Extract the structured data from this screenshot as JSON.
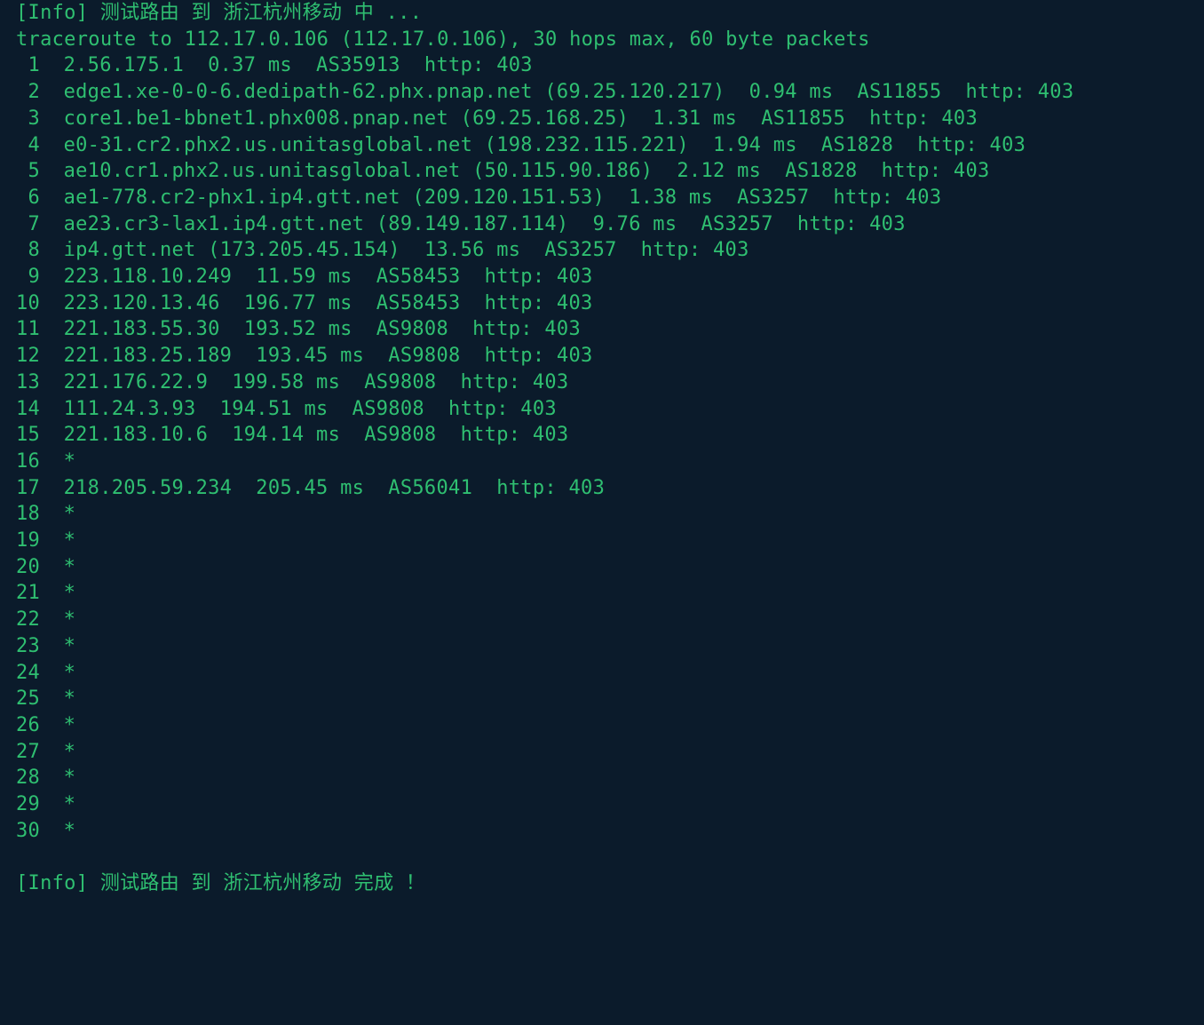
{
  "info_prefix": "[Info]",
  "header_start": "测试路由 到 浙江杭州移动 中 ...",
  "traceroute_header": "traceroute to 112.17.0.106 (112.17.0.106), 30 hops max, 60 byte packets",
  "hops": [
    {
      "n": 1,
      "rest": "2.56.175.1  0.37 ms  AS35913  http: 403"
    },
    {
      "n": 2,
      "rest": "edge1.xe-0-0-6.dedipath-62.phx.pnap.net (69.25.120.217)  0.94 ms  AS11855  http: 403"
    },
    {
      "n": 3,
      "rest": "core1.be1-bbnet1.phx008.pnap.net (69.25.168.25)  1.31 ms  AS11855  http: 403"
    },
    {
      "n": 4,
      "rest": "e0-31.cr2.phx2.us.unitasglobal.net (198.232.115.221)  1.94 ms  AS1828  http: 403"
    },
    {
      "n": 5,
      "rest": "ae10.cr1.phx2.us.unitasglobal.net (50.115.90.186)  2.12 ms  AS1828  http: 403"
    },
    {
      "n": 6,
      "rest": "ae1-778.cr2-phx1.ip4.gtt.net (209.120.151.53)  1.38 ms  AS3257  http: 403"
    },
    {
      "n": 7,
      "rest": "ae23.cr3-lax1.ip4.gtt.net (89.149.187.114)  9.76 ms  AS3257  http: 403"
    },
    {
      "n": 8,
      "rest": "ip4.gtt.net (173.205.45.154)  13.56 ms  AS3257  http: 403"
    },
    {
      "n": 9,
      "rest": "223.118.10.249  11.59 ms  AS58453  http: 403"
    },
    {
      "n": 10,
      "rest": "223.120.13.46  196.77 ms  AS58453  http: 403"
    },
    {
      "n": 11,
      "rest": "221.183.55.30  193.52 ms  AS9808  http: 403"
    },
    {
      "n": 12,
      "rest": "221.183.25.189  193.45 ms  AS9808  http: 403"
    },
    {
      "n": 13,
      "rest": "221.176.22.9  199.58 ms  AS9808  http: 403"
    },
    {
      "n": 14,
      "rest": "111.24.3.93  194.51 ms  AS9808  http: 403"
    },
    {
      "n": 15,
      "rest": "221.183.10.6  194.14 ms  AS9808  http: 403"
    },
    {
      "n": 16,
      "rest": "*"
    },
    {
      "n": 17,
      "rest": "218.205.59.234  205.45 ms  AS56041  http: 403"
    },
    {
      "n": 18,
      "rest": "*"
    },
    {
      "n": 19,
      "rest": "*"
    },
    {
      "n": 20,
      "rest": "*"
    },
    {
      "n": 21,
      "rest": "*"
    },
    {
      "n": 22,
      "rest": "*"
    },
    {
      "n": 23,
      "rest": "*"
    },
    {
      "n": 24,
      "rest": "*"
    },
    {
      "n": 25,
      "rest": "*"
    },
    {
      "n": 26,
      "rest": "*"
    },
    {
      "n": 27,
      "rest": "*"
    },
    {
      "n": 28,
      "rest": "*"
    },
    {
      "n": 29,
      "rest": "*"
    },
    {
      "n": 30,
      "rest": "*"
    }
  ],
  "footer": "测试路由 到 浙江杭州移动 完成 ！",
  "chart_data": {
    "type": "table",
    "title": "traceroute to 112.17.0.106",
    "target_ip": "112.17.0.106",
    "destination_label": "浙江杭州移动",
    "max_hops": 30,
    "packet_bytes": 60,
    "columns": [
      "hop",
      "host",
      "ip",
      "latency_ms",
      "asn",
      "http_status"
    ],
    "rows": [
      [
        1,
        null,
        "2.56.175.1",
        0.37,
        "AS35913",
        403
      ],
      [
        2,
        "edge1.xe-0-0-6.dedipath-62.phx.pnap.net",
        "69.25.120.217",
        0.94,
        "AS11855",
        403
      ],
      [
        3,
        "core1.be1-bbnet1.phx008.pnap.net",
        "69.25.168.25",
        1.31,
        "AS11855",
        403
      ],
      [
        4,
        "e0-31.cr2.phx2.us.unitasglobal.net",
        "198.232.115.221",
        1.94,
        "AS1828",
        403
      ],
      [
        5,
        "ae10.cr1.phx2.us.unitasglobal.net",
        "50.115.90.186",
        2.12,
        "AS1828",
        403
      ],
      [
        6,
        "ae1-778.cr2-phx1.ip4.gtt.net",
        "209.120.151.53",
        1.38,
        "AS3257",
        403
      ],
      [
        7,
        "ae23.cr3-lax1.ip4.gtt.net",
        "89.149.187.114",
        9.76,
        "AS3257",
        403
      ],
      [
        8,
        "ip4.gtt.net",
        "173.205.45.154",
        13.56,
        "AS3257",
        403
      ],
      [
        9,
        null,
        "223.118.10.249",
        11.59,
        "AS58453",
        403
      ],
      [
        10,
        null,
        "223.120.13.46",
        196.77,
        "AS58453",
        403
      ],
      [
        11,
        null,
        "221.183.55.30",
        193.52,
        "AS9808",
        403
      ],
      [
        12,
        null,
        "221.183.25.189",
        193.45,
        "AS9808",
        403
      ],
      [
        13,
        null,
        "221.176.22.9",
        199.58,
        "AS9808",
        403
      ],
      [
        14,
        null,
        "111.24.3.93",
        194.51,
        "AS9808",
        403
      ],
      [
        15,
        null,
        "221.183.10.6",
        194.14,
        "AS9808",
        403
      ],
      [
        16,
        null,
        null,
        null,
        null,
        null
      ],
      [
        17,
        null,
        "218.205.59.234",
        205.45,
        "AS56041",
        403
      ],
      [
        18,
        null,
        null,
        null,
        null,
        null
      ],
      [
        19,
        null,
        null,
        null,
        null,
        null
      ],
      [
        20,
        null,
        null,
        null,
        null,
        null
      ],
      [
        21,
        null,
        null,
        null,
        null,
        null
      ],
      [
        22,
        null,
        null,
        null,
        null,
        null
      ],
      [
        23,
        null,
        null,
        null,
        null,
        null
      ],
      [
        24,
        null,
        null,
        null,
        null,
        null
      ],
      [
        25,
        null,
        null,
        null,
        null,
        null
      ],
      [
        26,
        null,
        null,
        null,
        null,
        null
      ],
      [
        27,
        null,
        null,
        null,
        null,
        null
      ],
      [
        28,
        null,
        null,
        null,
        null,
        null
      ],
      [
        29,
        null,
        null,
        null,
        null,
        null
      ],
      [
        30,
        null,
        null,
        null,
        null,
        null
      ]
    ]
  }
}
